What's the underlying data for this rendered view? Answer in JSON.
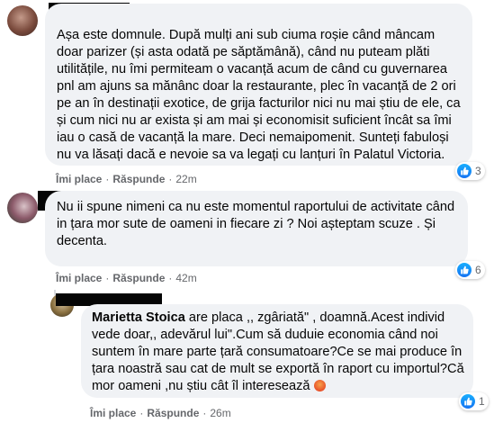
{
  "comments": [
    {
      "text": "Așa este domnule. După mulți ani sub ciuma roșie când mâncam doar parizer (și asta odată pe săptămână), când nu puteam plăti utilitățile, nu îmi permiteam o vacanță acum de când cu guvernarea pnl am ajuns sa mănânc doar la restaurante, plec în vacanță de 2 ori pe an în destinații exotice, de grija facturilor nici nu mai știu de ele, ca și cum nici nu ar exista și am mai și economisit suficient încât sa îmi iau o casă de vacanță la mare. Deci nemaipomenit. Sunteți fabuloși nu va lăsați dacă e nevoie sa va legați cu lanțuri în Palatul Victoria.",
      "like_label": "Îmi place",
      "reply_label": "Răspunde",
      "time": "22m",
      "reactions": "3"
    },
    {
      "text": "Nu ii spune nimeni ca nu este momentul raportului de activitate când in țara mor sute de oameni in fiecare zi ? Noi așteptam scuze . Și decenta.",
      "like_label": "Îmi place",
      "reply_label": "Răspunde",
      "time": "42m",
      "reactions": "6"
    },
    {
      "author": "Marietta Stoica",
      "text": "are placa ,, zgâriată\" , doamnă.Acest individ vede doar,, adevărul lui\".Cum să duduie economia când noi suntem în mare parte țară consumatoare?Ce se mai produce în țara noastră sau cat de mult se exportă în raport cu importul?Că mor oameni ,nu știu cât îl interesează",
      "like_label": "Îmi place",
      "reply_label": "Răspunde",
      "time": "26m",
      "reactions": "1"
    }
  ],
  "colors": {
    "bubble": "#f0f2f5",
    "secondary_text": "#65676b",
    "like_blue": "#1877f2"
  }
}
